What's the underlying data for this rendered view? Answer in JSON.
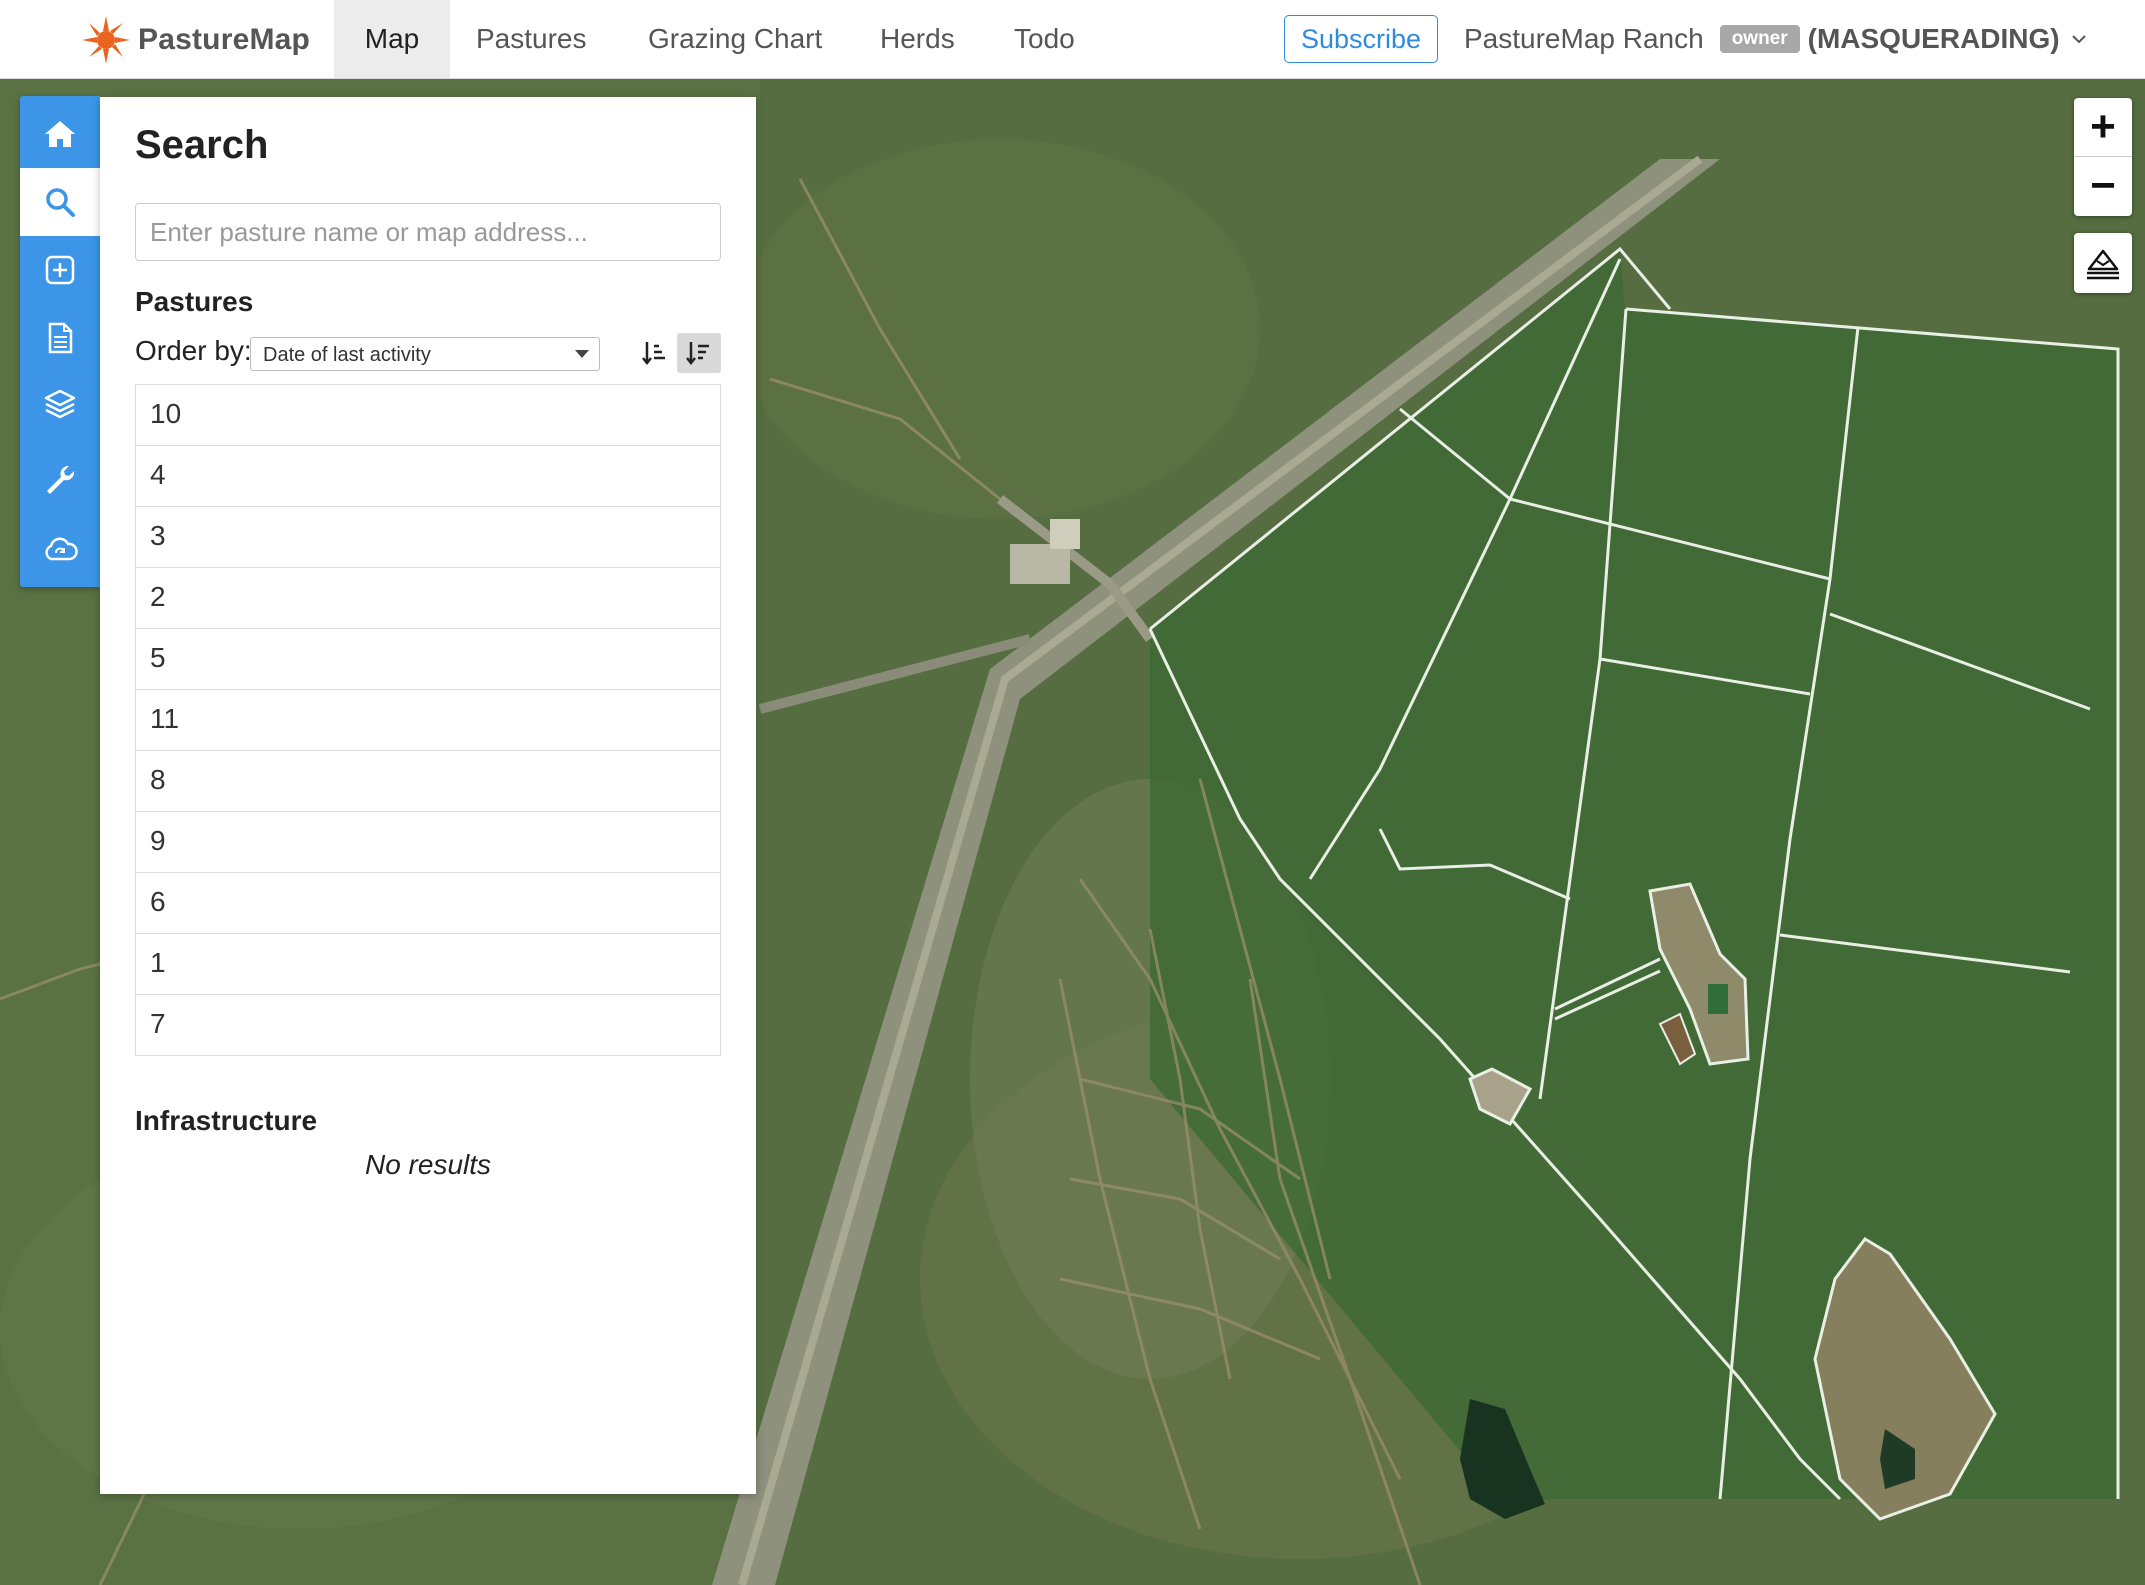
{
  "nav": {
    "brand": "PastureMap",
    "items": [
      {
        "label": "Map",
        "active": true
      },
      {
        "label": "Pastures",
        "active": false
      },
      {
        "label": "Grazing Chart",
        "active": false
      },
      {
        "label": "Herds",
        "active": false
      },
      {
        "label": "Todo",
        "active": false
      }
    ],
    "subscribe_label": "Subscribe",
    "ranch_name": "PastureMap Ranch",
    "role_badge": "owner",
    "masquerade": "(MASQUERADING)"
  },
  "toolbar": {
    "tools": [
      {
        "name": "home-icon",
        "active": false
      },
      {
        "name": "search-icon",
        "active": true
      },
      {
        "name": "add-square-icon",
        "active": false
      },
      {
        "name": "document-icon",
        "active": false
      },
      {
        "name": "layers-icon",
        "active": false
      },
      {
        "name": "wrench-icon",
        "active": false
      },
      {
        "name": "cloud-sync-icon",
        "active": false
      }
    ]
  },
  "search": {
    "title": "Search",
    "placeholder": "Enter pasture name or map address...",
    "value": "",
    "pastures_title": "Pastures",
    "order_by_label": "Order by:",
    "order_by_value": "Date of last activity",
    "pastures": [
      "10",
      "4",
      "3",
      "2",
      "5",
      "11",
      "8",
      "9",
      "6",
      "1",
      "7"
    ],
    "infrastructure_title": "Infrastructure",
    "infrastructure_empty": "No results"
  },
  "map_controls": {
    "zoom_in": "+",
    "zoom_out": "−"
  },
  "colors": {
    "accent": "#3c95e6",
    "subscribe": "#2f8be0",
    "brand_orange": "#e8641f",
    "badge": "#a8a8a8",
    "fence": "#e9efe4"
  }
}
